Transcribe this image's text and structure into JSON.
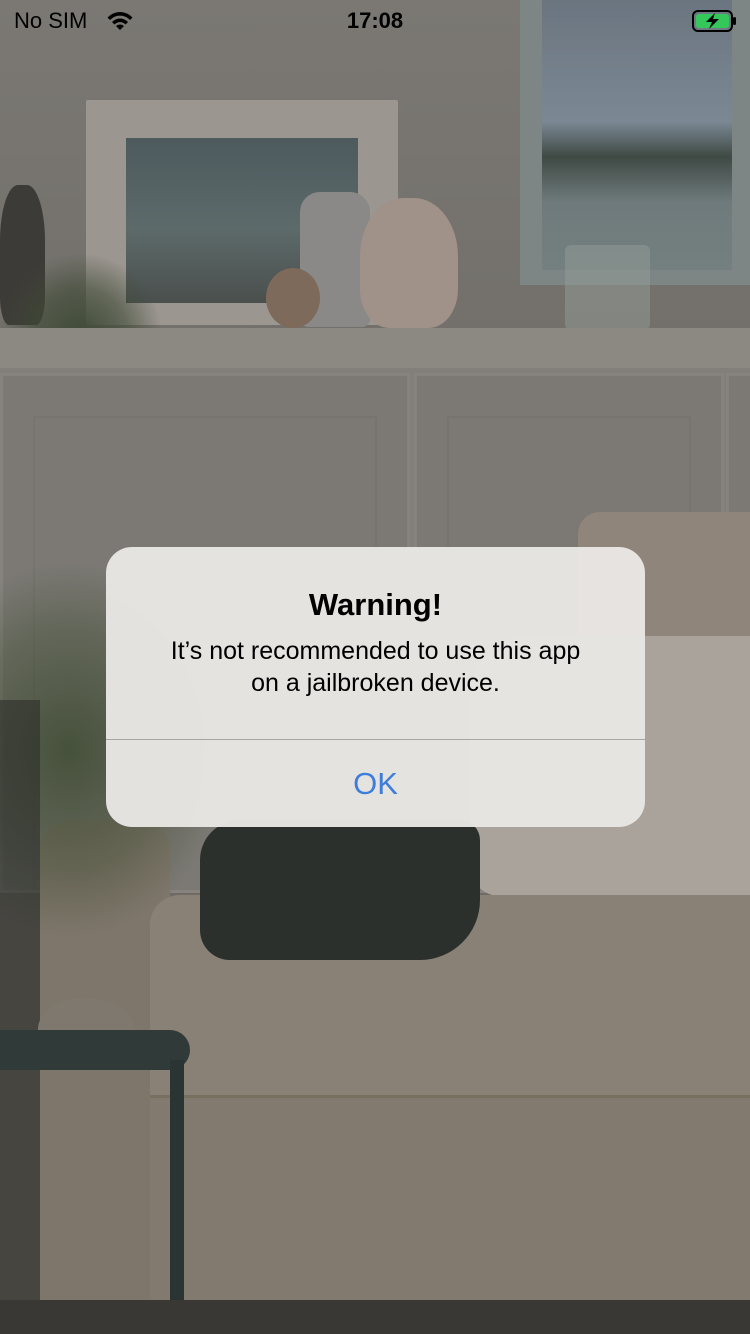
{
  "status_bar": {
    "carrier": "No SIM",
    "time": "17:08",
    "wifi_icon": "wifi-icon",
    "battery_icon": "battery-charging-icon",
    "battery_color": "#34c759"
  },
  "alert": {
    "title": "Warning!",
    "message_line1": "It’s not recommended to use this app",
    "message_line2": "on a jailbroken device.",
    "ok_label": "OK",
    "ok_color": "#3d7ddb"
  }
}
